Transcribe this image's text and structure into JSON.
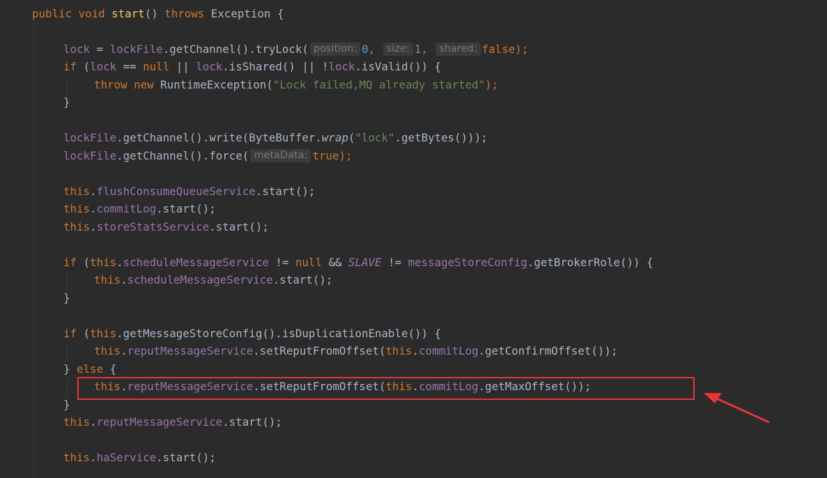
{
  "code": {
    "l1": {
      "kw_public": "public ",
      "kw_void": "void ",
      "fn_start": "start",
      "p_open": "() ",
      "kw_throws": "throws ",
      "p_exc": "Exception {"
    },
    "l3": {
      "v_lock": "lock",
      "p_eq": " = ",
      "v_lockfile": "lockFile",
      "p_call": ".getChannel().tryLock(",
      "h_position": "position:",
      "n0": "0",
      "c1": ", ",
      "h_size": "size:",
      "n1": "1",
      "c2": ", ",
      "h_shared": "shared:",
      "kw_false": "false",
      "p_end": ");"
    },
    "l4": {
      "kw_if": "if ",
      "p_a": "(",
      "v_lock1": "lock",
      "p_b": " == ",
      "kw_null": "null",
      "p_c": " || ",
      "v_lock2": "lock",
      "p_d": ".isShared() || !",
      "v_lock3": "lock",
      "p_e": ".isValid()) {"
    },
    "l5": {
      "kw_throw": "throw ",
      "kw_new": "new ",
      "p_a": "RuntimeException(",
      "str": "\"Lock failed,MQ already started\"",
      "p_b": ");"
    },
    "l6": {
      "p": "}"
    },
    "l8": {
      "v_lockfile": "lockFile",
      "p_a": ".getChannel().write(ByteBuffer.",
      "m_wrap": "wrap",
      "p_b": "(",
      "str": "\"lock\"",
      "p_c": ".getBytes()));"
    },
    "l9": {
      "v_lockfile": "lockFile",
      "p_a": ".getChannel().force(",
      "h_meta": "metaData:",
      "kw_true": "true",
      "p_b": ");"
    },
    "l11": {
      "kw_this": "this",
      "p_dot": ".",
      "fld": "flushConsumeQueueService",
      "p_rest": ".start();"
    },
    "l12": {
      "kw_this": "this",
      "p_dot": ".",
      "fld": "commitLog",
      "p_rest": ".start();"
    },
    "l13": {
      "kw_this": "this",
      "p_dot": ".",
      "fld": "storeStatsService",
      "p_rest": ".start();"
    },
    "l15": {
      "kw_if": "if ",
      "p_a": "(",
      "kw_this": "this",
      "p_dot": ".",
      "fld": "scheduleMessageService",
      "p_b": " != ",
      "kw_null": "null",
      "p_c": " && ",
      "s_slave": "SLAVE",
      "p_d": " != ",
      "fld2": "messageStoreConfig",
      "p_e": ".getBrokerRole()) {"
    },
    "l16": {
      "kw_this": "this",
      "p_dot": ".",
      "fld": "scheduleMessageService",
      "p_rest": ".start();"
    },
    "l17": {
      "p": "}"
    },
    "l19": {
      "kw_if": "if ",
      "p_a": "(",
      "kw_this": "this",
      "p_b": ".getMessageStoreConfig().isDuplicationEnable()) {"
    },
    "l20": {
      "kw_this": "this",
      "p_dot": ".",
      "fld": "reputMessageService",
      "p_a": ".setReputFromOffset(",
      "kw_this2": "this",
      "p_dot2": ".",
      "fld2": "commitLog",
      "p_b": ".getConfirmOffset());"
    },
    "l21": {
      "p_a": "} ",
      "kw_else": "else",
      "p_b": " {"
    },
    "l22": {
      "kw_this": "this",
      "p_dot": ".",
      "fld": "reputMessageService",
      "p_a": ".setReputFromOffset(",
      "kw_this2": "this",
      "p_dot2": ".",
      "fld2": "commitLog",
      "p_b": ".getMaxOffset());"
    },
    "l23": {
      "p": "}"
    },
    "l24": {
      "kw_this": "this",
      "p_dot": ".",
      "fld": "reputMessageService",
      "p_rest": ".start();"
    },
    "l26": {
      "kw_this": "this",
      "p_dot": ".",
      "fld": "haService",
      "p_rest": ".start();"
    }
  },
  "colors": {
    "background": "#2b2b2b",
    "keyword": "#cc7832",
    "method_decl": "#ffc66d",
    "field": "#9876aa",
    "string": "#6a8759",
    "number": "#6897bb",
    "plain": "#a9b7c6",
    "annotation": "#e8343a"
  }
}
